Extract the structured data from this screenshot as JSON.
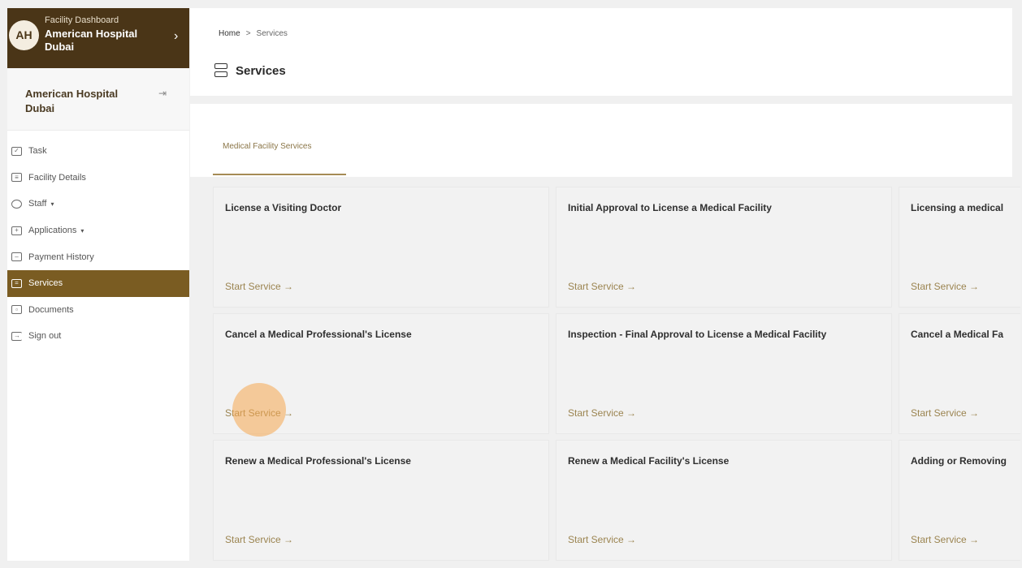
{
  "facility_switcher": {
    "avatar_initials": "AH",
    "subtitle": "Facility Dashboard",
    "name": "American Hospital Dubai"
  },
  "facility_block": {
    "name": "American Hospital Dubai"
  },
  "nav": {
    "items": [
      {
        "label": "Task",
        "icon": "task-icon"
      },
      {
        "label": "Facility Details",
        "icon": "facility-details-icon"
      },
      {
        "label": "Staff",
        "icon": "staff-icon",
        "has_caret": true
      },
      {
        "label": "Applications",
        "icon": "applications-icon",
        "has_caret": true
      },
      {
        "label": "Payment History",
        "icon": "payment-history-icon"
      },
      {
        "label": "Services",
        "icon": "services-icon",
        "active": true
      },
      {
        "label": "Documents",
        "icon": "documents-icon"
      },
      {
        "label": "Sign out",
        "icon": "sign-out-icon"
      }
    ]
  },
  "breadcrumb": {
    "home": "Home",
    "separator": ">",
    "current": "Services"
  },
  "page": {
    "title": "Services"
  },
  "tabs": [
    {
      "label": "Medical Facility Services",
      "active": true
    }
  ],
  "cards": [
    {
      "title": "License a Visiting Doctor",
      "action": "Start Service →"
    },
    {
      "title": "Initial Approval to License a Medical Facility",
      "action": "Start Service →"
    },
    {
      "title": "Licensing a medical",
      "action": "Start Service →"
    },
    {
      "title": "Cancel a Medical Professional's License",
      "action": "Start Service →"
    },
    {
      "title": "Inspection - Final Approval to License a Medical Facility",
      "action": "Start Service →"
    },
    {
      "title": "Cancel a Medical Fa",
      "action": "Start Service →"
    },
    {
      "title": "Renew a Medical Professional's License",
      "action": "Start Service →"
    },
    {
      "title": "Renew a Medical Facility's License",
      "action": "Start Service →"
    },
    {
      "title": "Adding or Removing",
      "action": "Start Service →"
    }
  ],
  "colors": {
    "brand_dark": "#4a3517",
    "active_nav": "#7a5c22",
    "accent_text": "#9b8450",
    "click_highlight": "#f5a850"
  }
}
